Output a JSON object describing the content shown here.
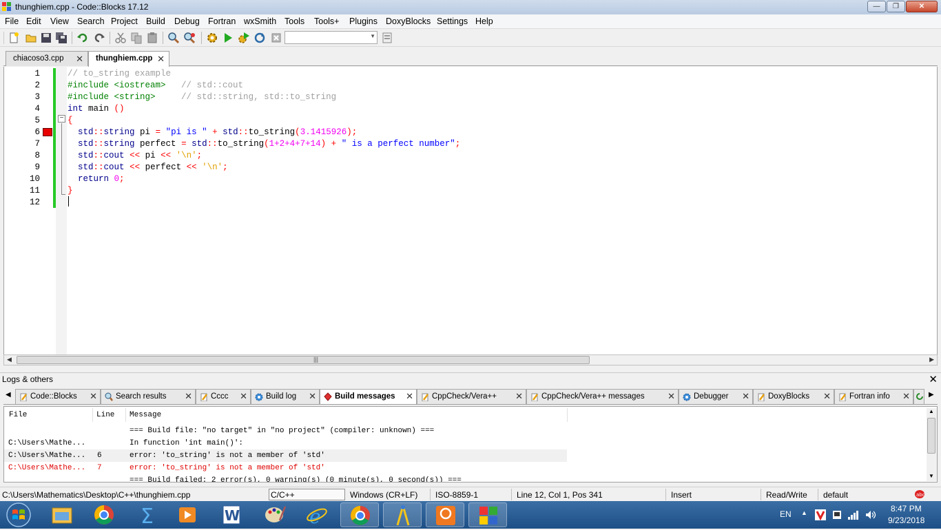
{
  "window": {
    "title": "thunghiem.cpp - Code::Blocks 17.12"
  },
  "menu": [
    "File",
    "Edit",
    "View",
    "Search",
    "Project",
    "Build",
    "Debug",
    "Fortran",
    "wxSmith",
    "Tools",
    "Tools+",
    "Plugins",
    "DoxyBlocks",
    "Settings",
    "Help"
  ],
  "editor_tabs": [
    {
      "label": "chiacoso3.cpp",
      "active": false
    },
    {
      "label": "thunghiem.cpp",
      "active": true
    }
  ],
  "editor": {
    "line_numbers": [
      "1",
      "2",
      "3",
      "4",
      "5",
      "6",
      "7",
      "8",
      "9",
      "10",
      "11",
      "12"
    ],
    "breakpoint_line": "6",
    "lines": [
      [
        {
          "t": "// to_string example",
          "c": "com"
        }
      ],
      [
        {
          "t": "#include <iostream>",
          "c": "pre"
        },
        {
          "t": "   ",
          "c": "txt"
        },
        {
          "t": "// std::cout",
          "c": "com"
        }
      ],
      [
        {
          "t": "#include <string>",
          "c": "pre"
        },
        {
          "t": "     ",
          "c": "txt"
        },
        {
          "t": "// std::string, std::to_string",
          "c": "com"
        }
      ],
      [
        {
          "t": "int",
          "c": "kw"
        },
        {
          "t": " main ",
          "c": "txt"
        },
        {
          "t": "()",
          "c": "op"
        }
      ],
      [
        {
          "t": "{",
          "c": "op"
        }
      ],
      [
        {
          "t": "  std",
          "c": "kw"
        },
        {
          "t": "::",
          "c": "op"
        },
        {
          "t": "string",
          "c": "kw"
        },
        {
          "t": " pi ",
          "c": "txt"
        },
        {
          "t": "=",
          "c": "op"
        },
        {
          "t": " ",
          "c": "txt"
        },
        {
          "t": "\"pi is \"",
          "c": "str"
        },
        {
          "t": " + ",
          "c": "op"
        },
        {
          "t": "std",
          "c": "kw"
        },
        {
          "t": "::",
          "c": "op"
        },
        {
          "t": "to_string",
          "c": "txt"
        },
        {
          "t": "(",
          "c": "op"
        },
        {
          "t": "3.1415926",
          "c": "num"
        },
        {
          "t": ");",
          "c": "op"
        }
      ],
      [
        {
          "t": "  std",
          "c": "kw"
        },
        {
          "t": "::",
          "c": "op"
        },
        {
          "t": "string",
          "c": "kw"
        },
        {
          "t": " perfect ",
          "c": "txt"
        },
        {
          "t": "=",
          "c": "op"
        },
        {
          "t": " ",
          "c": "txt"
        },
        {
          "t": "std",
          "c": "kw"
        },
        {
          "t": "::",
          "c": "op"
        },
        {
          "t": "to_string",
          "c": "txt"
        },
        {
          "t": "(",
          "c": "op"
        },
        {
          "t": "1+2+4+7+14",
          "c": "num"
        },
        {
          "t": ") + ",
          "c": "op"
        },
        {
          "t": "\" is a perfect number\"",
          "c": "str"
        },
        {
          "t": ";",
          "c": "op"
        }
      ],
      [
        {
          "t": "  std",
          "c": "kw"
        },
        {
          "t": "::",
          "c": "op"
        },
        {
          "t": "cout",
          "c": "kw"
        },
        {
          "t": " ",
          "c": "txt"
        },
        {
          "t": "<<",
          "c": "op"
        },
        {
          "t": " pi ",
          "c": "txt"
        },
        {
          "t": "<<",
          "c": "op"
        },
        {
          "t": " ",
          "c": "txt"
        },
        {
          "t": "'\\n'",
          "c": "chr"
        },
        {
          "t": ";",
          "c": "op"
        }
      ],
      [
        {
          "t": "  std",
          "c": "kw"
        },
        {
          "t": "::",
          "c": "op"
        },
        {
          "t": "cout",
          "c": "kw"
        },
        {
          "t": " ",
          "c": "txt"
        },
        {
          "t": "<<",
          "c": "op"
        },
        {
          "t": " perfect ",
          "c": "txt"
        },
        {
          "t": "<<",
          "c": "op"
        },
        {
          "t": " ",
          "c": "txt"
        },
        {
          "t": "'\\n'",
          "c": "chr"
        },
        {
          "t": ";",
          "c": "op"
        }
      ],
      [
        {
          "t": "  return",
          "c": "kw"
        },
        {
          "t": " ",
          "c": "txt"
        },
        {
          "t": "0",
          "c": "num"
        },
        {
          "t": ";",
          "c": "op"
        }
      ],
      [
        {
          "t": "}",
          "c": "op"
        }
      ],
      []
    ]
  },
  "logs": {
    "title": "Logs & others",
    "tabs": [
      {
        "label": "Code::Blocks",
        "icon": "note-icon",
        "active": false
      },
      {
        "label": "Search results",
        "icon": "search-icon",
        "active": false
      },
      {
        "label": "Cccc",
        "icon": "note-icon",
        "active": false
      },
      {
        "label": "Build log",
        "icon": "gear-icon",
        "active": false
      },
      {
        "label": "Build messages",
        "icon": "diamond-icon",
        "active": true
      },
      {
        "label": "CppCheck/Vera++",
        "icon": "note-icon",
        "active": false
      },
      {
        "label": "CppCheck/Vera++ messages",
        "icon": "note-icon",
        "active": false
      },
      {
        "label": "Debugger",
        "icon": "gear-icon",
        "active": false
      },
      {
        "label": "DoxyBlocks",
        "icon": "note-icon",
        "active": false
      },
      {
        "label": "Fortran info",
        "icon": "note-icon",
        "active": false
      }
    ],
    "columns": [
      "File",
      "Line",
      "Message"
    ],
    "rows": [
      {
        "file": "",
        "line": "",
        "message": "=== Build file: \"no target\" in \"no project\" (compiler: unknown) ===",
        "type": "info"
      },
      {
        "file": "C:\\Users\\Mathe...",
        "line": "",
        "message": "In function 'int main()':",
        "type": "info"
      },
      {
        "file": "C:\\Users\\Mathe...",
        "line": "6",
        "message": "error: 'to_string' is not a member of 'std'",
        "type": "selected"
      },
      {
        "file": "C:\\Users\\Mathe...",
        "line": "7",
        "message": "error: 'to_string' is not a member of 'std'",
        "type": "error"
      },
      {
        "file": "",
        "line": "",
        "message": "=== Build failed: 2 error(s), 0 warning(s) (0 minute(s), 0 second(s)) ===",
        "type": "info"
      }
    ]
  },
  "status": {
    "path": "C:\\Users\\Mathematics\\Desktop\\C++\\thunghiem.cpp",
    "lang": "C/C++",
    "eol": "Windows (CR+LF)",
    "encoding": "ISO-8859-1",
    "position": "Line 12, Col 1, Pos 341",
    "mode": "Insert",
    "access": "Read/Write",
    "profile": "default"
  },
  "taskbar": {
    "lang": "EN",
    "time": "8:47 PM",
    "date": "9/23/2018"
  },
  "colors": {
    "changebar": "#27c927",
    "breakpoint": "#e80000",
    "error_text": "#e00000"
  }
}
